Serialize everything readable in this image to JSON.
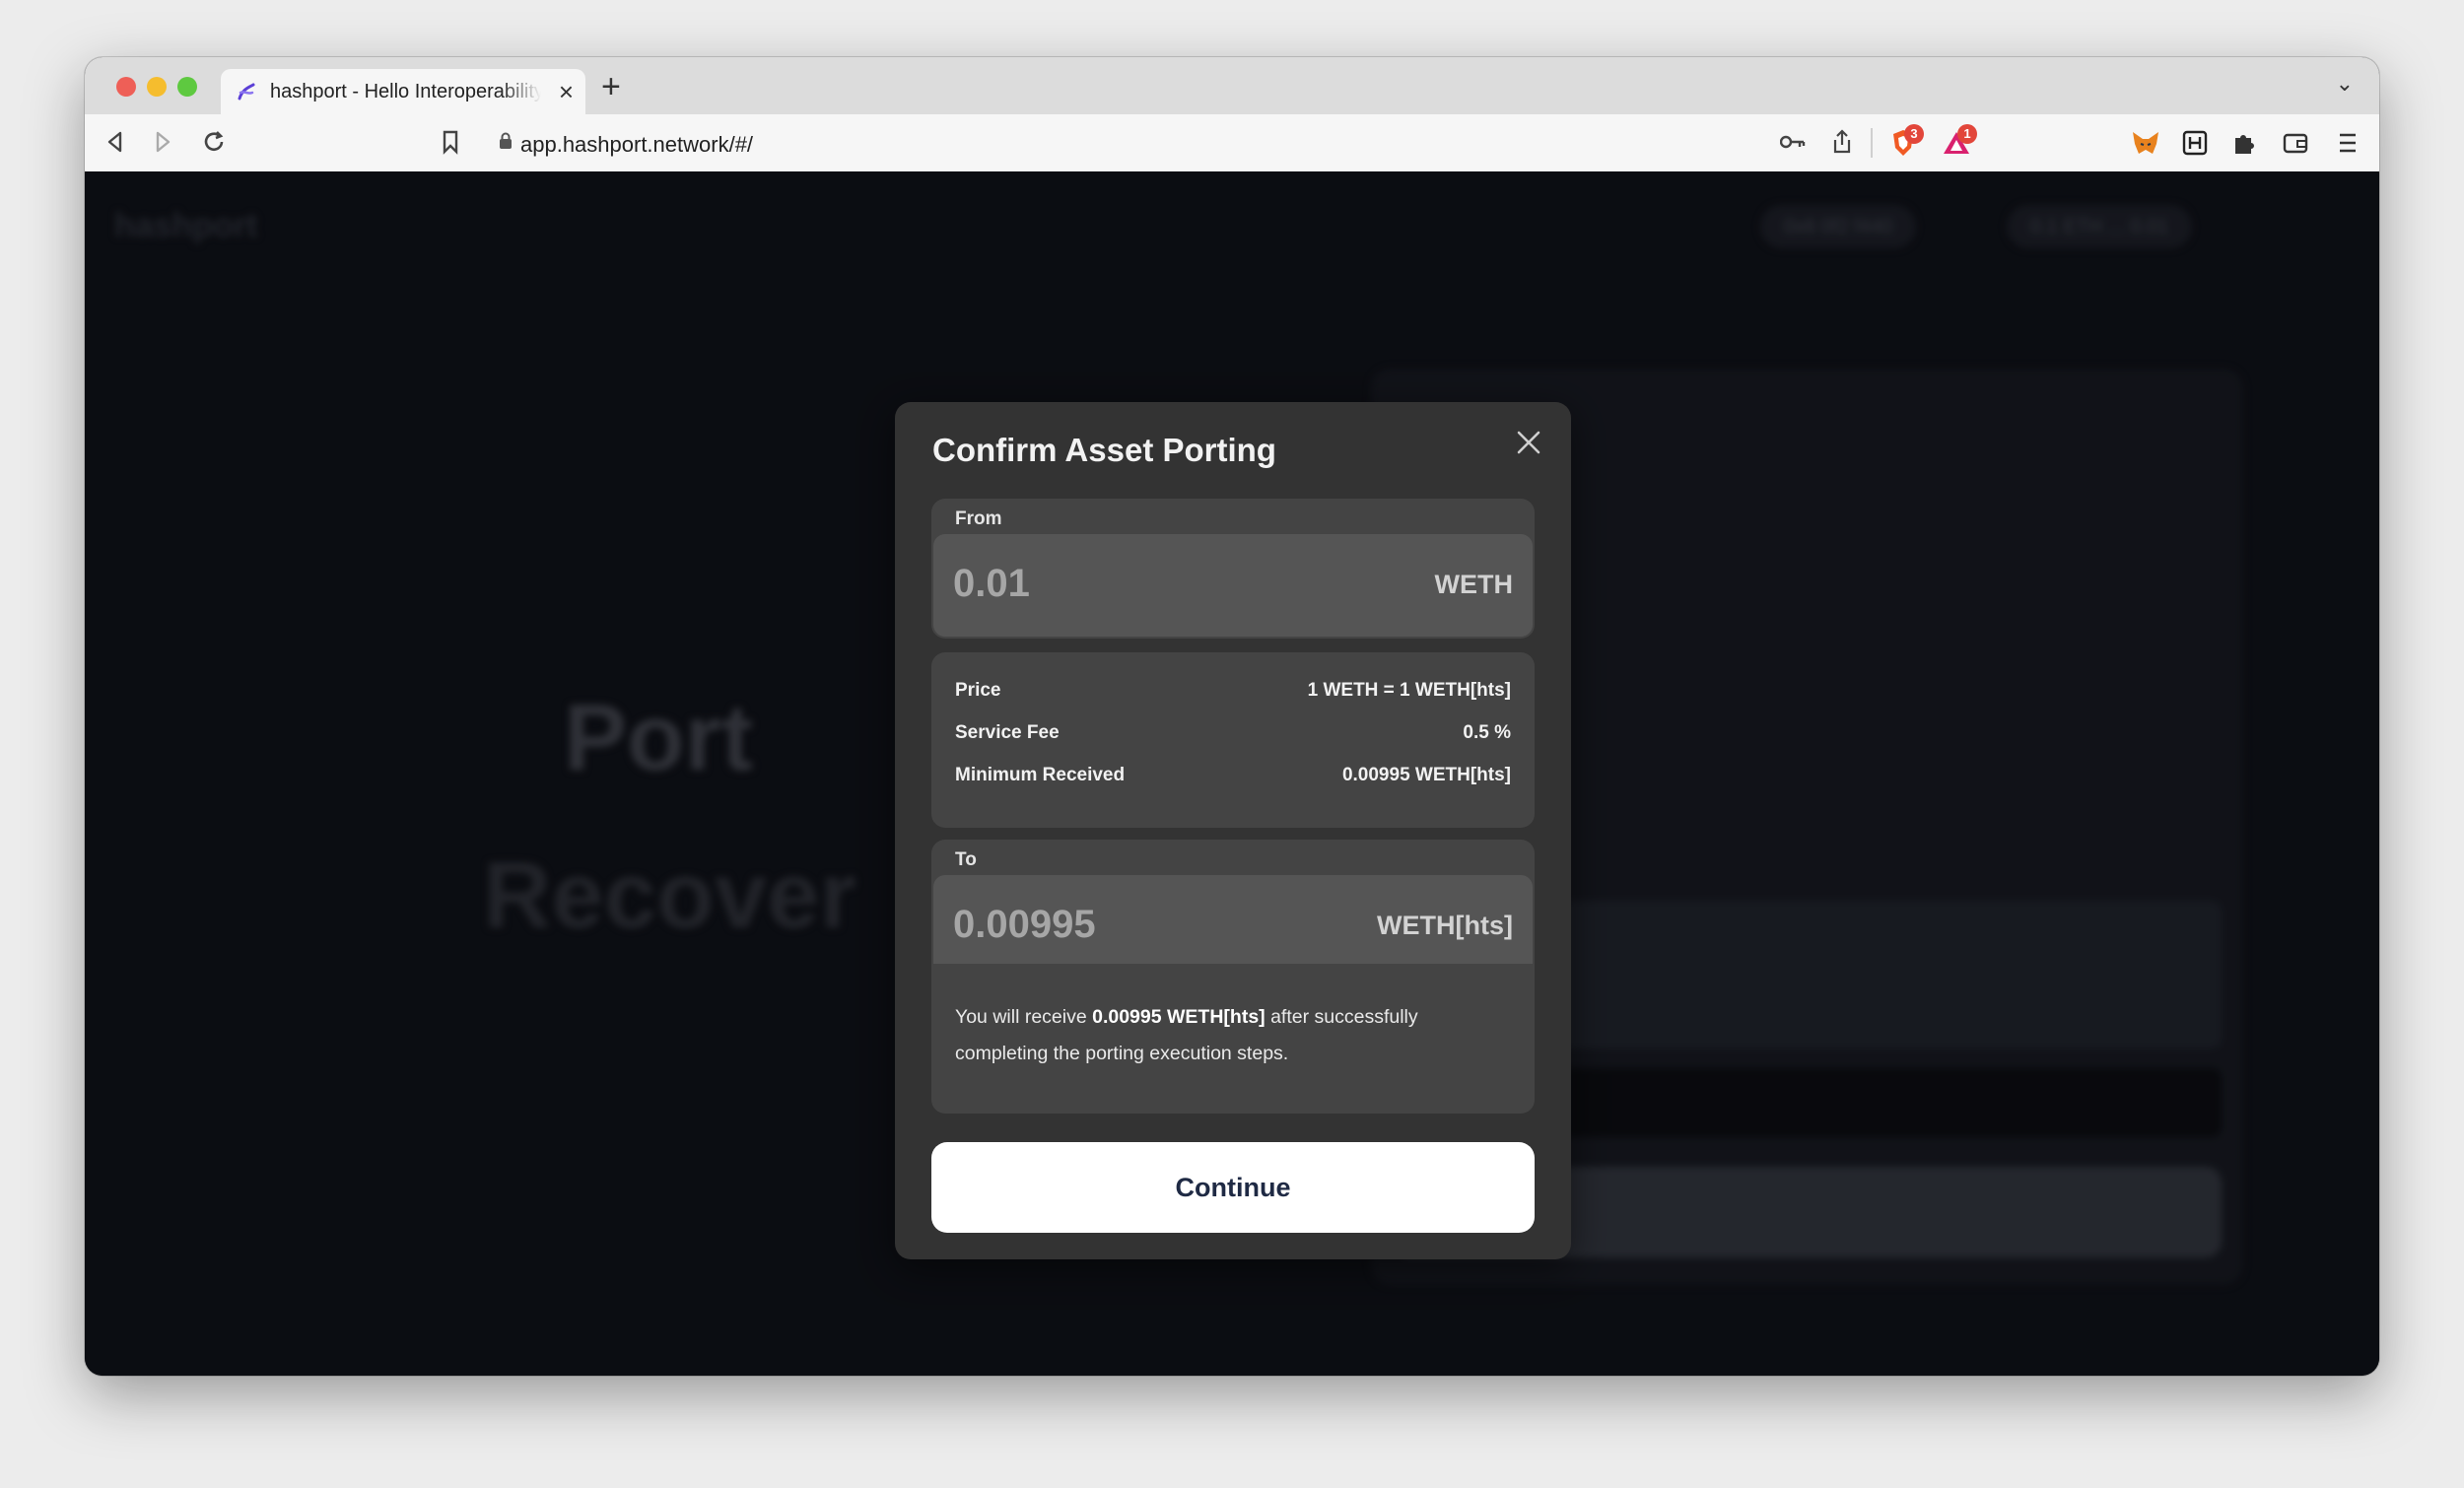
{
  "browser": {
    "tab": {
      "title": "hashport - Hello Interoperability"
    },
    "url": "app.hashport.network/#/",
    "badges": {
      "shield_count": "3",
      "rewards_count": "1"
    }
  },
  "background": {
    "brand": "hashport",
    "pill_1": "0x6 0f2 f440",
    "pill_2": "0.1 ETH ... 0.01",
    "port": "Port",
    "recover": "Recover"
  },
  "modal": {
    "title": "Confirm Asset Porting",
    "from": {
      "label": "From",
      "amount": "0.01",
      "symbol": "WETH"
    },
    "details": [
      {
        "label": "Price",
        "value": "1 WETH = 1 WETH[hts]"
      },
      {
        "label": "Service Fee",
        "value": "0.5 %"
      },
      {
        "label": "Minimum Received",
        "value": "0.00995 WETH[hts]"
      }
    ],
    "to": {
      "label": "To",
      "amount": "0.00995",
      "symbol": "WETH[hts]"
    },
    "note": {
      "prefix": "You will receive ",
      "amount": "0.00995 WETH[hts]",
      "suffix": " after successfully completing the porting execution steps."
    },
    "continue_label": "Continue"
  },
  "colors": {
    "modal_bg": "#333333",
    "panel_bg": "#444444",
    "input_bg": "#555555",
    "button_text": "#1f2a44"
  }
}
